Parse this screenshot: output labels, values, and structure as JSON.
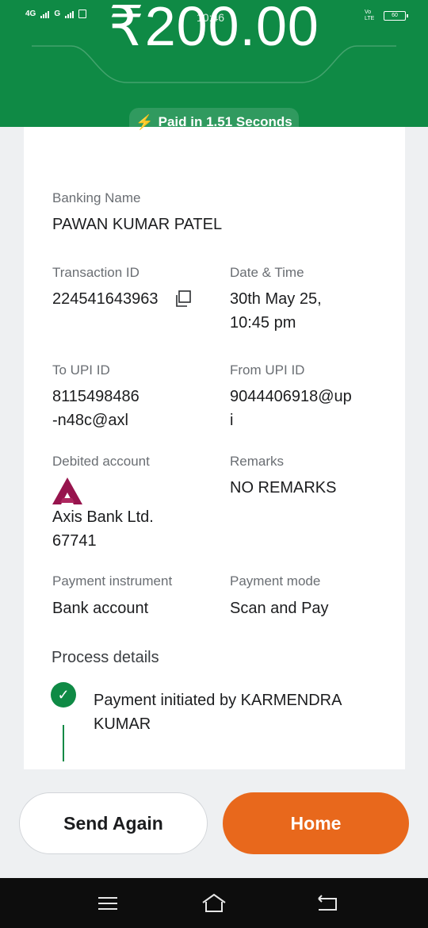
{
  "status_bar": {
    "left_network_1": "4G",
    "left_network_2": "G",
    "time": "10:46",
    "right_carrier": "Vo LTE",
    "battery": "60"
  },
  "header": {
    "amount": "₹200.00",
    "paid_text": "Paid in 1.51 Seconds",
    "bg_color": "#0f8a45",
    "bolt_color": "#f7b500"
  },
  "details": {
    "banking_name_label": "Banking Name",
    "banking_name_value": "PAWAN KUMAR PATEL",
    "transaction_id_label": "Transaction ID",
    "transaction_id_value": "224541643963",
    "datetime_label": "Date & Time",
    "datetime_line1": "30th May 25,",
    "datetime_line2": "10:45 pm",
    "to_upi_label": "To UPI ID",
    "to_upi_line1": "8115498486",
    "to_upi_line2": "-n48c@axl",
    "from_upi_label": "From UPI ID",
    "from_upi_line1": "9044406918@up",
    "from_upi_line2": "i",
    "debited_label": "Debited account",
    "debited_bank": "Axis Bank Ltd.",
    "debited_acct": "67741",
    "remarks_label": "Remarks",
    "remarks_value": "NO REMARKS",
    "instrument_label": "Payment instrument",
    "instrument_value": "Bank account",
    "mode_label": "Payment mode",
    "mode_value": "Scan and Pay"
  },
  "process": {
    "title": "Process details",
    "step1_line1": "Payment initiated by KARMENDRA",
    "step1_line2": "KUMAR"
  },
  "buttons": {
    "send_again": "Send Again",
    "home": "Home",
    "home_color": "#e8681c"
  },
  "icons": {
    "copy": "copy-icon",
    "axis_logo": "axis-bank-logo",
    "check": "check-icon",
    "bolt": "lightning-bolt-icon",
    "nav_menu": "menu-icon",
    "nav_home": "home-icon",
    "nav_back": "back-icon"
  }
}
